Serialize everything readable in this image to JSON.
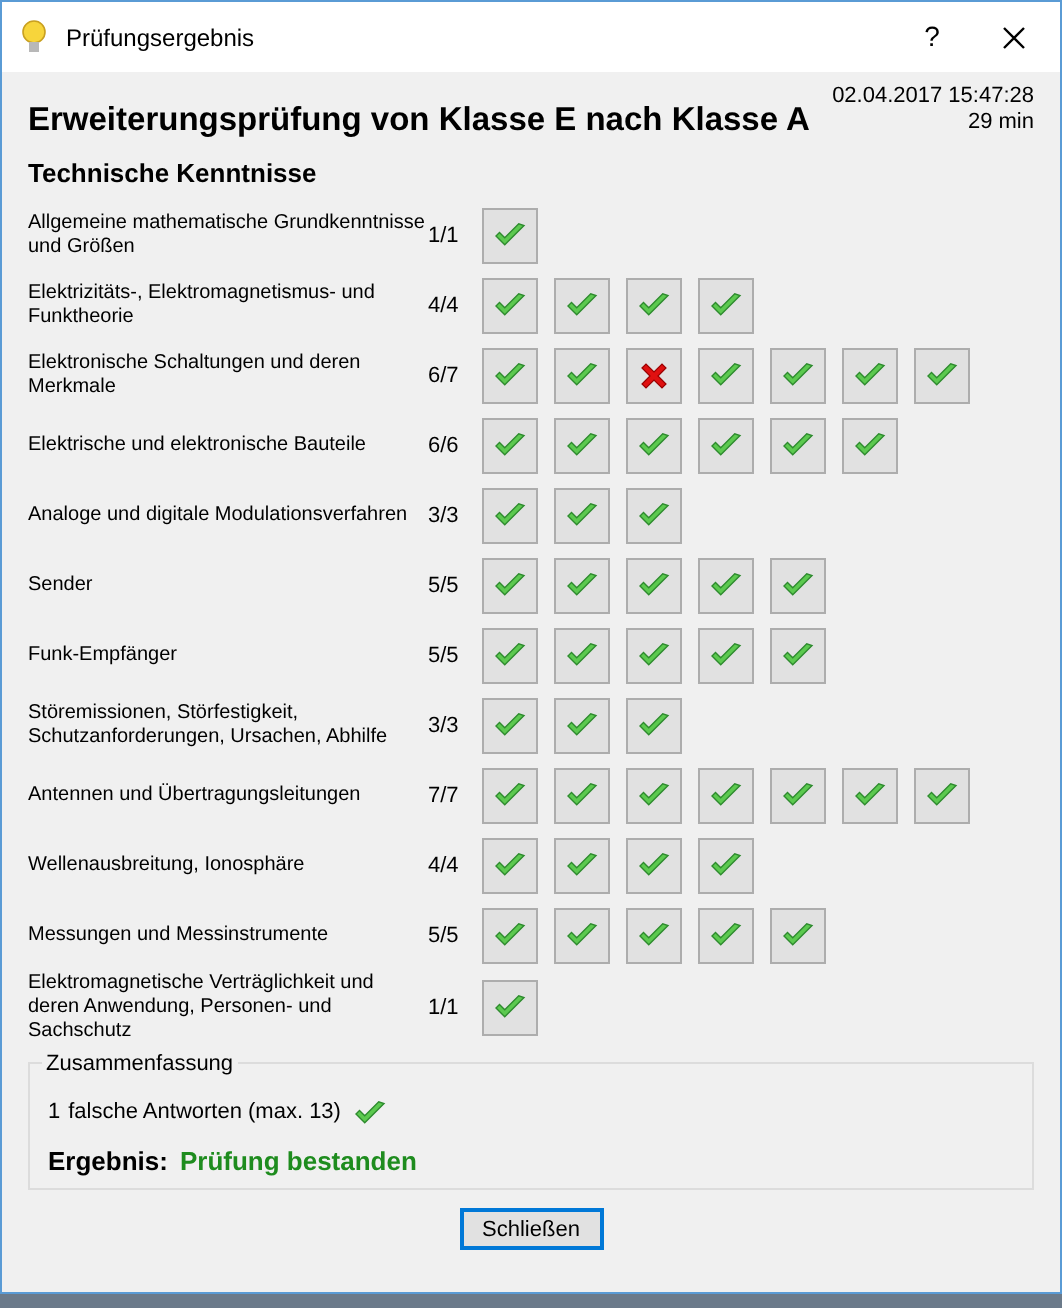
{
  "window": {
    "title": "Prüfungsergebnis",
    "help": "?"
  },
  "heading": "Erweiterungsprüfung von Klasse E nach Klasse A",
  "date": "02.04.2017 15:47:28",
  "duration": "29 min",
  "section": "Technische Kenntnisse",
  "topics": [
    {
      "name": "Allgemeine mathematische Grundkenntnisse und Größen",
      "score": "1/1",
      "answers": [
        {
          "correct": true
        }
      ]
    },
    {
      "name": "Elektrizitäts-, Elektromagnetismus- und Funktheorie",
      "score": "4/4",
      "answers": [
        {
          "correct": true
        },
        {
          "correct": true
        },
        {
          "correct": true
        },
        {
          "correct": true
        }
      ]
    },
    {
      "name": "Elektronische Schaltungen und deren Merkmale",
      "score": "6/7",
      "answers": [
        {
          "correct": true
        },
        {
          "correct": true
        },
        {
          "correct": false
        },
        {
          "correct": true
        },
        {
          "correct": true
        },
        {
          "correct": true
        },
        {
          "correct": true
        }
      ]
    },
    {
      "name": "Elektrische und elektronische Bauteile",
      "score": "6/6",
      "answers": [
        {
          "correct": true
        },
        {
          "correct": true
        },
        {
          "correct": true
        },
        {
          "correct": true
        },
        {
          "correct": true
        },
        {
          "correct": true
        }
      ]
    },
    {
      "name": "Analoge und digitale Modulationsverfahren",
      "score": "3/3",
      "answers": [
        {
          "correct": true
        },
        {
          "correct": true
        },
        {
          "correct": true
        }
      ]
    },
    {
      "name": "Sender",
      "score": "5/5",
      "answers": [
        {
          "correct": true
        },
        {
          "correct": true
        },
        {
          "correct": true
        },
        {
          "correct": true
        },
        {
          "correct": true
        }
      ]
    },
    {
      "name": "Funk-Empfänger",
      "score": "5/5",
      "answers": [
        {
          "correct": true
        },
        {
          "correct": true
        },
        {
          "correct": true
        },
        {
          "correct": true
        },
        {
          "correct": true
        }
      ]
    },
    {
      "name": "Störemissionen, Störfestigkeit, Schutzanforderungen, Ursachen, Abhilfe",
      "score": "3/3",
      "answers": [
        {
          "correct": true
        },
        {
          "correct": true
        },
        {
          "correct": true
        }
      ]
    },
    {
      "name": "Antennen und Übertragungsleitungen",
      "score": "7/7",
      "answers": [
        {
          "correct": true
        },
        {
          "correct": true
        },
        {
          "correct": true
        },
        {
          "correct": true
        },
        {
          "correct": true
        },
        {
          "correct": true
        },
        {
          "correct": true
        }
      ]
    },
    {
      "name": "Wellenausbreitung, Ionosphäre",
      "score": "4/4",
      "answers": [
        {
          "correct": true
        },
        {
          "correct": true
        },
        {
          "correct": true
        },
        {
          "correct": true
        }
      ]
    },
    {
      "name": "Messungen und Messinstrumente",
      "score": "5/5",
      "answers": [
        {
          "correct": true
        },
        {
          "correct": true
        },
        {
          "correct": true
        },
        {
          "correct": true
        },
        {
          "correct": true
        }
      ]
    },
    {
      "name": "Elektromagnetische Verträglichkeit und deren Anwendung, Personen- und Sachschutz",
      "score": "1/1",
      "answers": [
        {
          "correct": true
        }
      ]
    }
  ],
  "summary": {
    "title": "Zusammenfassung",
    "wrong_count": "1",
    "wrong_text": "falsche Antworten (max. 13)",
    "passed": true,
    "result_label": "Ergebnis:",
    "result": "Prüfung bestanden"
  },
  "buttons": [
    "Schließen"
  ]
}
